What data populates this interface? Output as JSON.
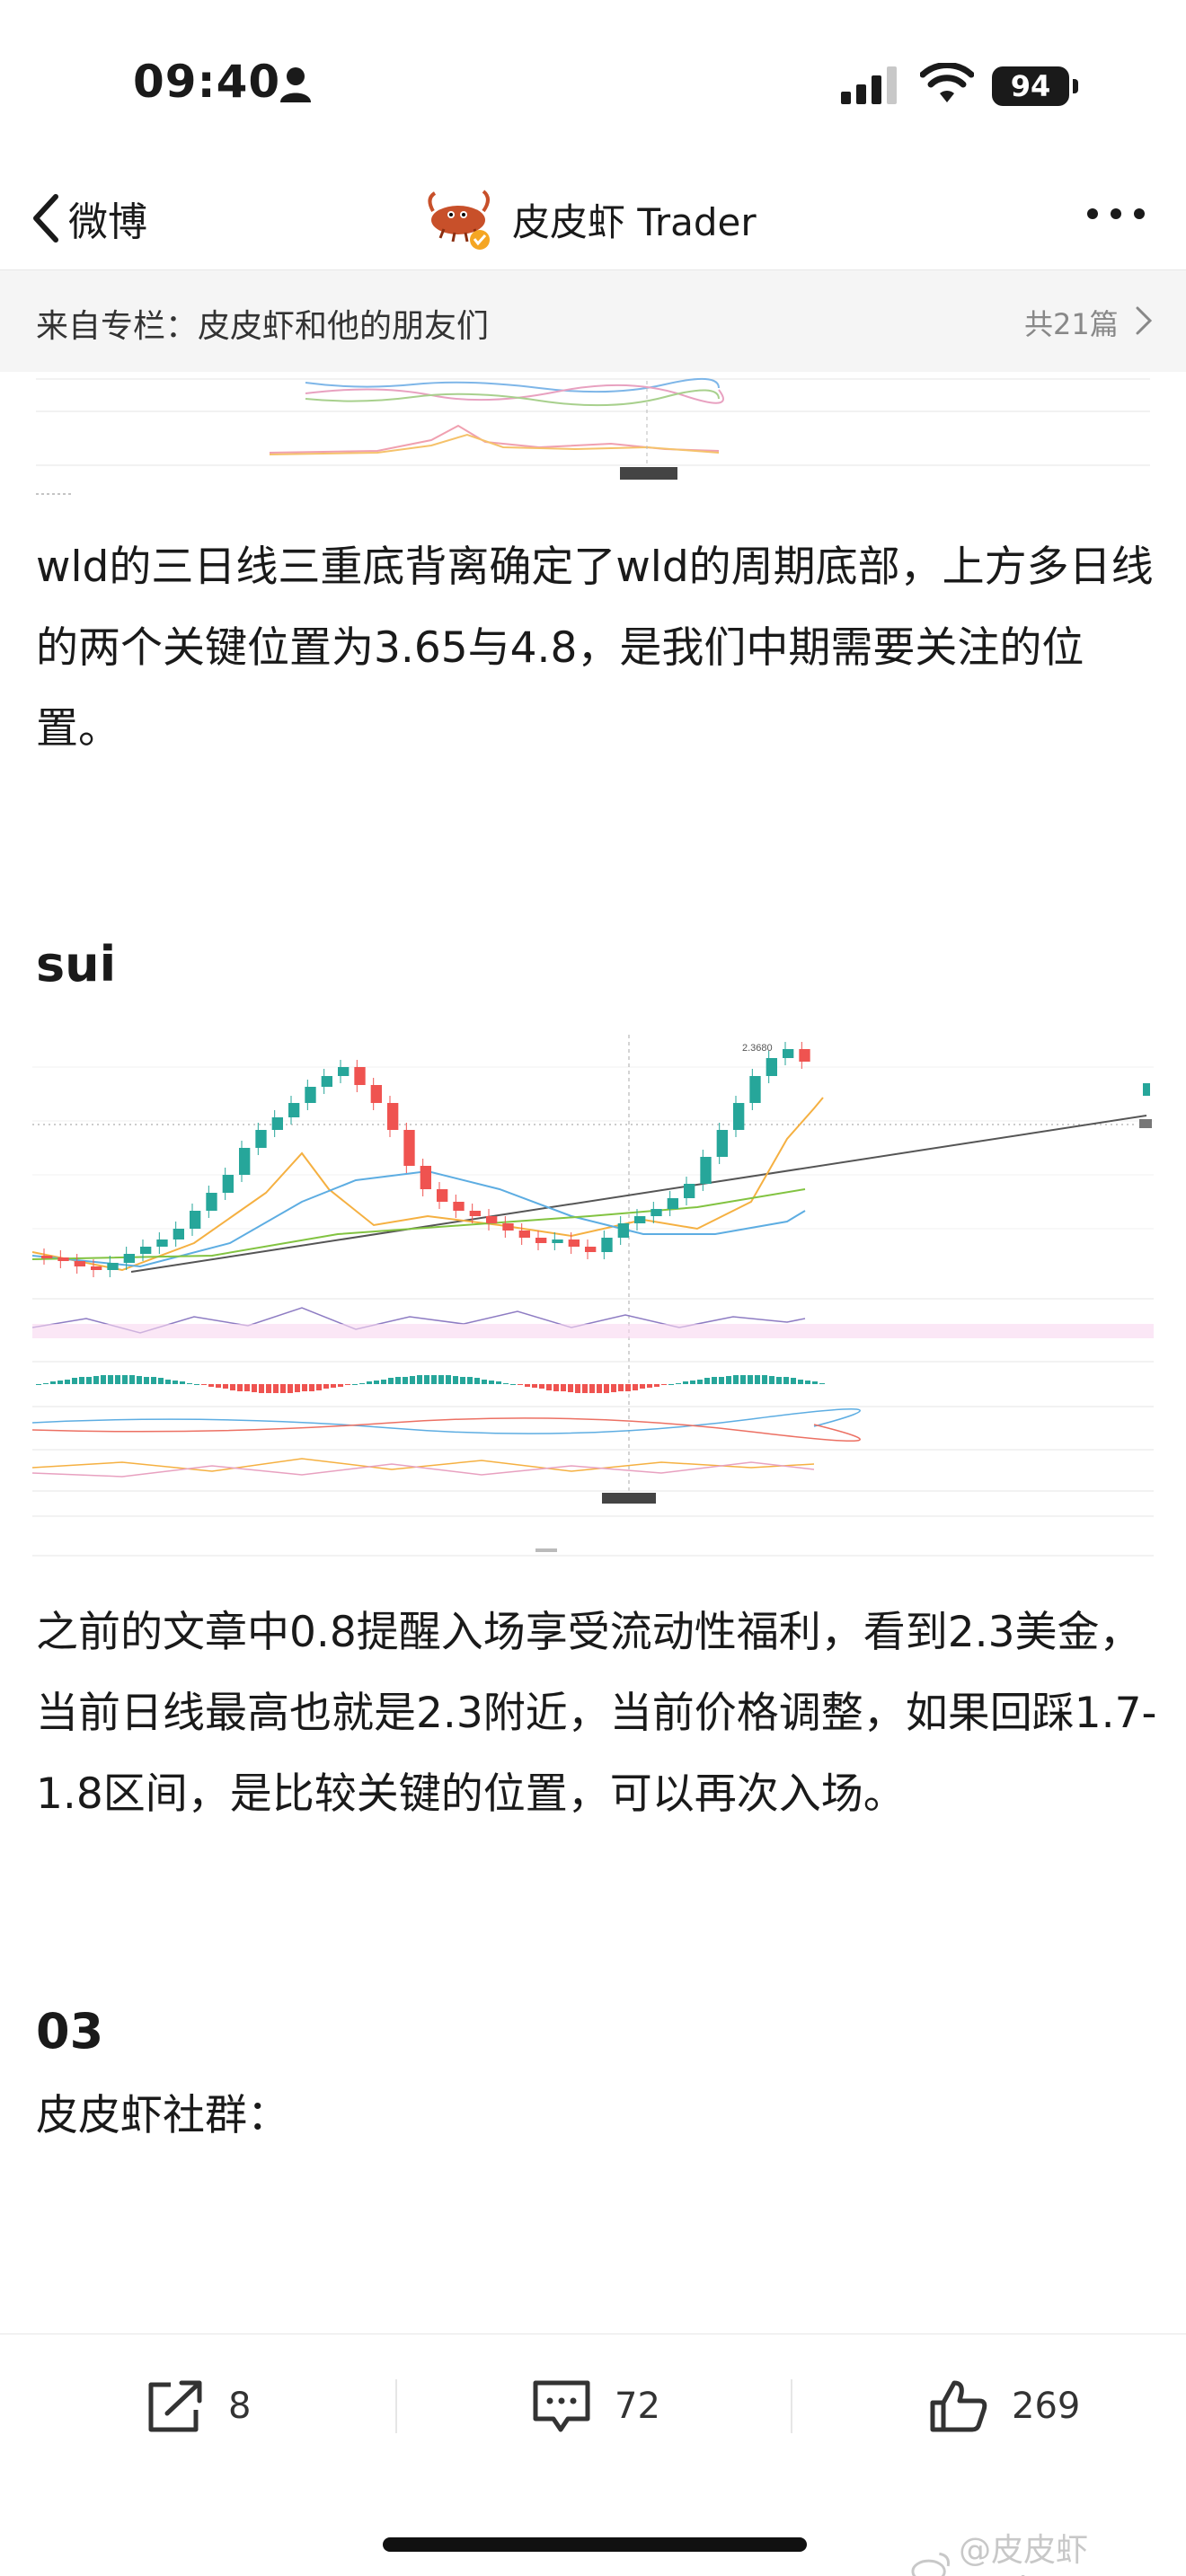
{
  "status_bar": {
    "time": "09:40",
    "battery": "94"
  },
  "nav": {
    "back_label": "微博",
    "title": "皮皮虾 Trader"
  },
  "column": {
    "title": "来自专栏：皮皮虾和他的朋友们",
    "count": "共21篇"
  },
  "article": {
    "p1": "wld的三日线三重底背离确定了wld的周期底部，上方多日线的两个关键位置为3.65与4.8，是我们中期需要关注的位置。",
    "h_sui": "sui",
    "p2": "之前的文章中0.8提醒入场享受流动性福利，看到2.3美金，当前日线最高也就是2.3附近，当前价格调整，如果回踩1.7-1.8区间，是比较关键的位置，可以再次入场。",
    "h_03": "03",
    "p3": "皮皮虾社群："
  },
  "actions": {
    "share_count": "8",
    "comment_count": "72",
    "like_count": "269"
  },
  "watermark": "@皮皮虾Trader",
  "colors": {
    "text": "#1a1a1a",
    "muted": "#888888",
    "column_bg": "#f5f5f5",
    "candle_up": "#26a69a",
    "candle_down": "#ef5350"
  }
}
